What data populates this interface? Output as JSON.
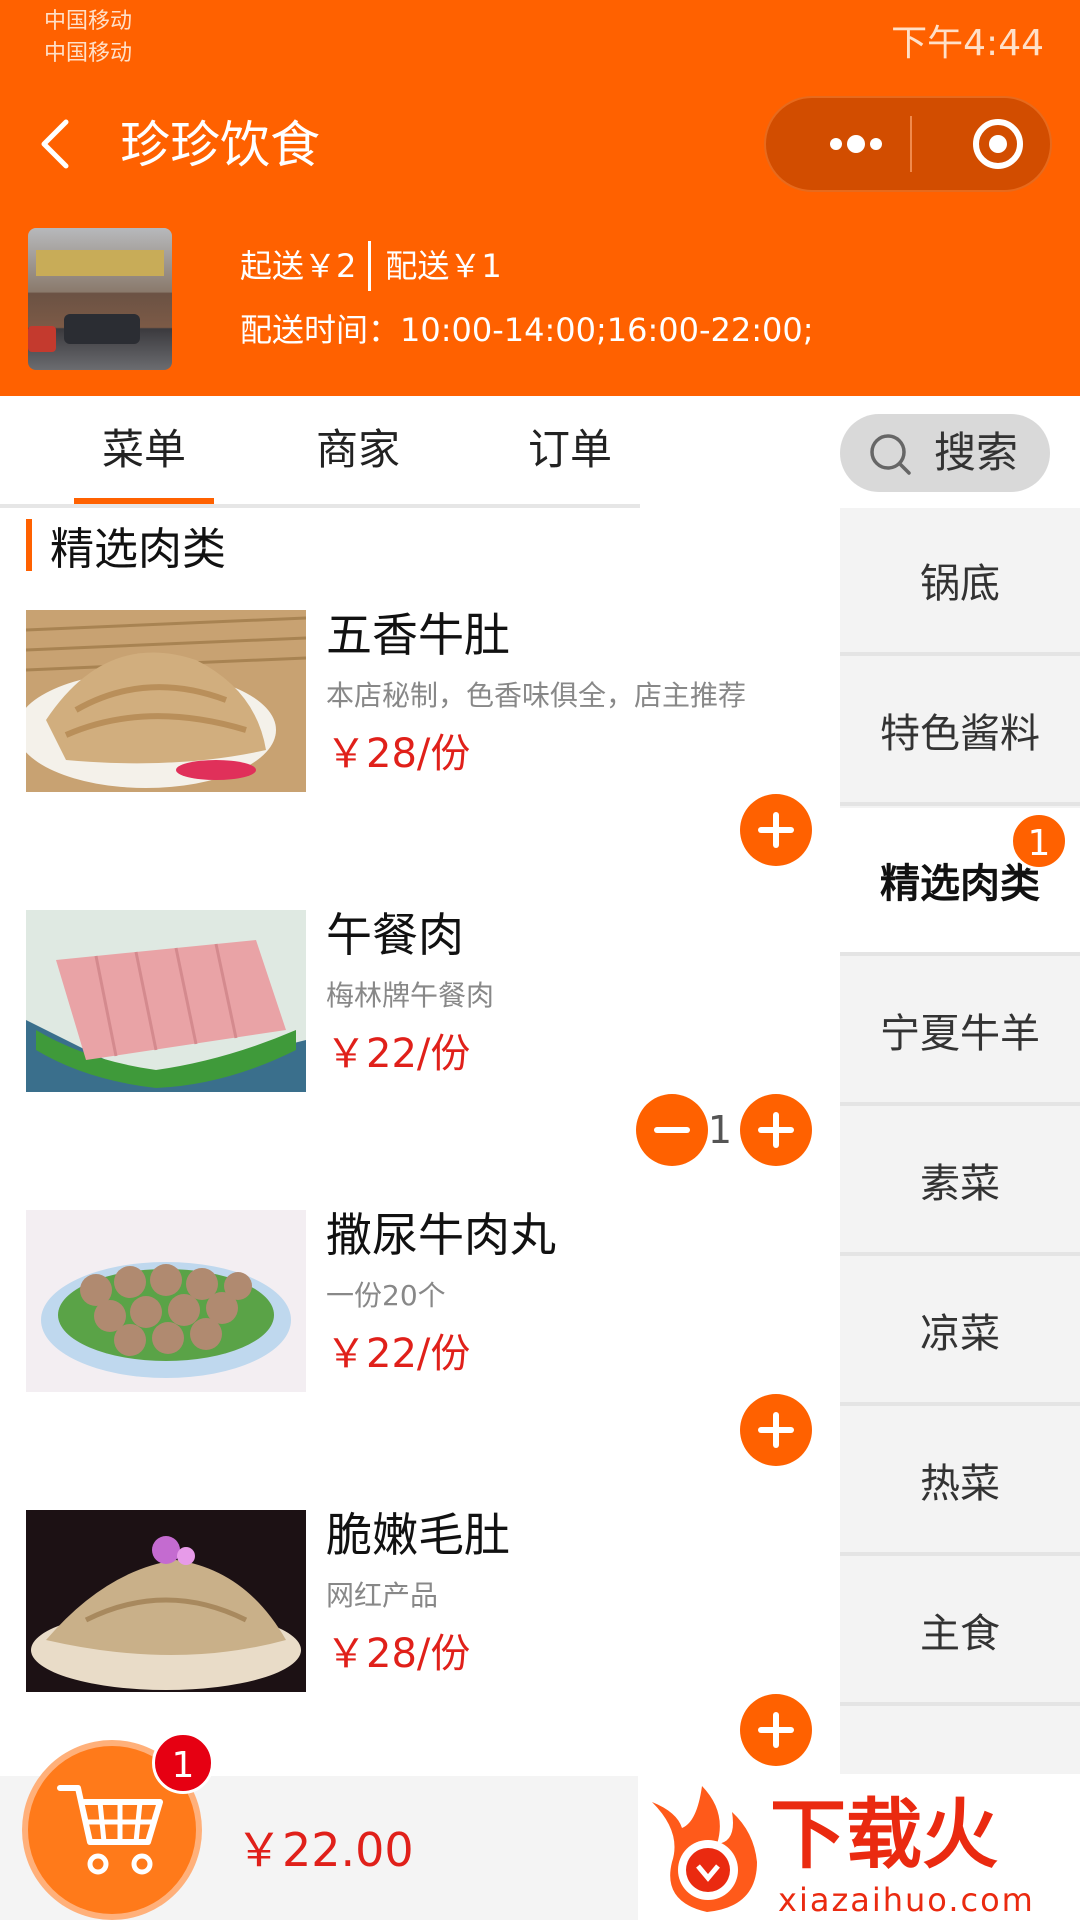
{
  "status_bar": {
    "carrier_1": "中国移动",
    "carrier_2": "中国移动",
    "time": "下午4:44"
  },
  "nav": {
    "title": "珍珍饮食",
    "icons": [
      "back-icon",
      "more-icon",
      "target-icon"
    ]
  },
  "shop_info": {
    "min_order": "起送￥2",
    "delivery_fee": "配送￥1",
    "delivery_time": "配送时间：10:00-14:00;16:00-22:00;"
  },
  "tabs": [
    {
      "label": "菜单",
      "active": true
    },
    {
      "label": "商家",
      "active": false
    },
    {
      "label": "订单",
      "active": false
    }
  ],
  "search": {
    "label": "搜索",
    "icon": "search-icon"
  },
  "section": {
    "title": "精选肉类"
  },
  "items": [
    {
      "name": "五香牛肚",
      "desc": "本店秘制，色香味俱全，店主推荐",
      "price": "￥28/份",
      "quantity": 0
    },
    {
      "name": "午餐肉",
      "desc": "梅林牌午餐肉",
      "price": "￥22/份",
      "quantity": 1,
      "quantity_label": "1"
    },
    {
      "name": "撒尿牛肉丸",
      "desc": "一份20个",
      "price": "￥22/份",
      "quantity": 0
    },
    {
      "name": "脆嫩毛肚",
      "desc": "网红产品",
      "price": "￥28/份",
      "quantity": 0
    }
  ],
  "categories": [
    {
      "label": "锅底"
    },
    {
      "label": "特色酱料"
    },
    {
      "label": "精选肉类",
      "active": true,
      "badge": "1"
    },
    {
      "label": "宁夏牛羊"
    },
    {
      "label": "素菜"
    },
    {
      "label": "凉菜"
    },
    {
      "label": "热菜"
    },
    {
      "label": "主食"
    }
  ],
  "cart": {
    "badge": "1",
    "total": "￥22.00",
    "icon": "cart-icon"
  },
  "watermark": {
    "text": "下载火",
    "url": "xiazaihuo.com"
  },
  "colors": {
    "accent": "#ff6100",
    "price": "#e0201a",
    "badge": "#e60012"
  }
}
